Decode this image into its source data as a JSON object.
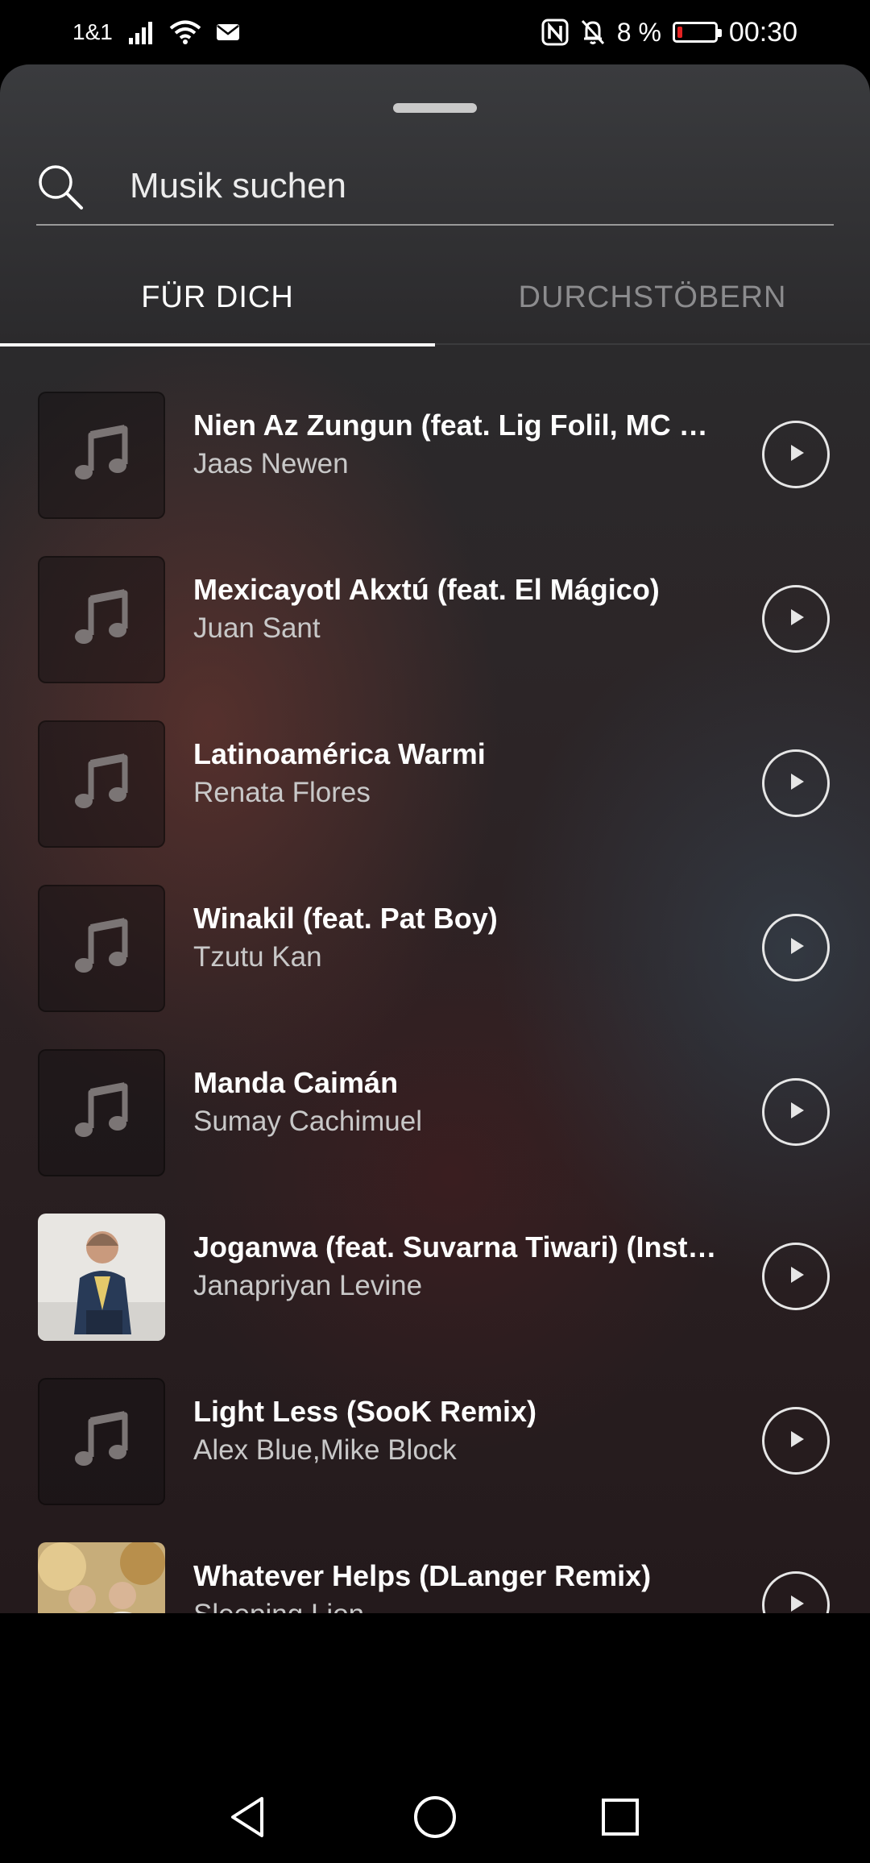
{
  "status_bar": {
    "carrier": "1&1",
    "battery_percent": "8 %",
    "time": "00:30",
    "icons": [
      "signal-icon",
      "wifi-icon",
      "mail-icon",
      "nfc-icon",
      "bell-muted-icon",
      "battery-icon"
    ],
    "battery_level": 0.08,
    "battery_color": "#e32222"
  },
  "search": {
    "placeholder": "Musik suchen",
    "value": ""
  },
  "tabs": [
    {
      "label": "FÜR DICH",
      "active": true
    },
    {
      "label": "DURCHSTÖBERN",
      "active": false
    }
  ],
  "tracks": [
    {
      "title": "Nien Az Zungun (feat. Lig Folil, MC Mil...",
      "artist": "Jaas Newen",
      "artwork": "music-note-icon"
    },
    {
      "title": "Mexicayotl Akxtú (feat. El Mágico)",
      "artist": "Juan Sant",
      "artwork": "music-note-icon"
    },
    {
      "title": "Latinoamérica Warmi",
      "artist": "Renata Flores",
      "artwork": "music-note-icon"
    },
    {
      "title": "Winakil (feat. Pat Boy)",
      "artist": "Tzutu Kan",
      "artwork": "music-note-icon"
    },
    {
      "title": "Manda Caimán",
      "artist": "Sumay Cachimuel",
      "artwork": "music-note-icon"
    },
    {
      "title": "Joganwa (feat. Suvarna Tiwari) (Instru...",
      "artist": "Janapriyan Levine",
      "artwork": "album-cover-photo"
    },
    {
      "title": "Light Less (SooK Remix)",
      "artist": "Alex Blue,Mike Block",
      "artwork": "music-note-icon"
    },
    {
      "title": "Whatever Helps (DLanger Remix)",
      "artist": "Sleeping Lion",
      "artwork": "album-cover-photo"
    }
  ],
  "navigation": {
    "icons": [
      "back-icon",
      "home-icon",
      "recents-icon"
    ]
  }
}
